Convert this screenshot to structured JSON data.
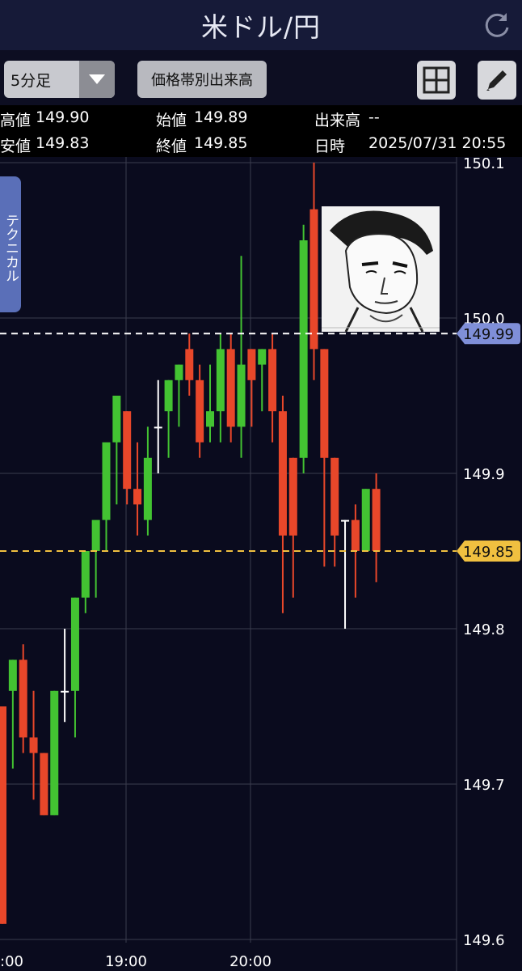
{
  "header": {
    "title": "米ドル/円"
  },
  "toolbar": {
    "timeframe": "5分足",
    "volume_button": "価格帯別出来高"
  },
  "info": {
    "high_label": "高値",
    "high_value": "149.90",
    "low_label": "安値",
    "low_value": "149.83",
    "open_label": "始値",
    "open_value": "149.89",
    "close_label": "終値",
    "close_value": "149.85",
    "volume_label": "出来高",
    "volume_value": "--",
    "datetime_label": "日時",
    "datetime_value": "2025/07/31 20:55"
  },
  "side_tab": {
    "label": "テクニカル"
  },
  "colors": {
    "up": "#43c332",
    "down": "#e8472a",
    "doji": "#ffffff",
    "bid_line": "#ffffff",
    "last_line": "#f0c040",
    "grid": "#3b3d4e",
    "background": "#0a0b1e"
  },
  "chart_data": {
    "type": "candlestick",
    "title": "米ドル/円",
    "interval": "5分足",
    "ylim": [
      149.6,
      150.1
    ],
    "y_ticks": [
      "149.6",
      "149.7",
      "149.8",
      "149.9",
      "150.0",
      "150.1"
    ],
    "x_ticks": [
      "19:00",
      "20:00"
    ],
    "x_tick_labels_shown": [
      ":00",
      "19:00",
      "20:00"
    ],
    "markers": [
      {
        "label": "149.99",
        "value": 149.99,
        "style": "dashed-white"
      },
      {
        "label": "149.85",
        "value": 149.85,
        "style": "dashed-yellow"
      }
    ],
    "candles": [
      {
        "open": 149.75,
        "high": 149.75,
        "low": 149.61,
        "close": 149.61
      },
      {
        "open": 149.76,
        "high": 149.78,
        "low": 149.71,
        "close": 149.78
      },
      {
        "open": 149.78,
        "high": 149.79,
        "low": 149.72,
        "close": 149.73
      },
      {
        "open": 149.73,
        "high": 149.76,
        "low": 149.69,
        "close": 149.72
      },
      {
        "open": 149.72,
        "high": 149.72,
        "low": 149.68,
        "close": 149.68
      },
      {
        "open": 149.68,
        "high": 149.76,
        "low": 149.68,
        "close": 149.76
      },
      {
        "open": 149.76,
        "high": 149.8,
        "low": 149.74,
        "close": 149.76
      },
      {
        "open": 149.76,
        "high": 149.82,
        "low": 149.73,
        "close": 149.82
      },
      {
        "open": 149.82,
        "high": 149.85,
        "low": 149.81,
        "close": 149.85
      },
      {
        "open": 149.85,
        "high": 149.86,
        "low": 149.82,
        "close": 149.87
      },
      {
        "open": 149.87,
        "high": 149.91,
        "low": 149.85,
        "close": 149.92
      },
      {
        "open": 149.92,
        "high": 149.95,
        "low": 149.88,
        "close": 149.95
      },
      {
        "open": 149.94,
        "high": 149.94,
        "low": 149.88,
        "close": 149.89
      },
      {
        "open": 149.89,
        "high": 149.92,
        "low": 149.86,
        "close": 149.88
      },
      {
        "open": 149.87,
        "high": 149.93,
        "low": 149.86,
        "close": 149.91
      },
      {
        "open": 149.93,
        "high": 149.96,
        "low": 149.9,
        "close": 149.93
      },
      {
        "open": 149.94,
        "high": 149.96,
        "low": 149.91,
        "close": 149.96
      },
      {
        "open": 149.96,
        "high": 149.97,
        "low": 149.93,
        "close": 149.97
      },
      {
        "open": 149.98,
        "high": 149.99,
        "low": 149.95,
        "close": 149.96
      },
      {
        "open": 149.96,
        "high": 149.97,
        "low": 149.91,
        "close": 149.92
      },
      {
        "open": 149.93,
        "high": 149.97,
        "low": 149.92,
        "close": 149.94
      },
      {
        "open": 149.94,
        "high": 149.99,
        "low": 149.92,
        "close": 149.98
      },
      {
        "open": 149.98,
        "high": 149.99,
        "low": 149.92,
        "close": 149.93
      },
      {
        "open": 149.93,
        "high": 150.04,
        "low": 149.91,
        "close": 149.97
      },
      {
        "open": 149.98,
        "high": 149.98,
        "low": 149.93,
        "close": 149.96
      },
      {
        "open": 149.97,
        "high": 149.98,
        "low": 149.94,
        "close": 149.98
      },
      {
        "open": 149.98,
        "high": 149.99,
        "low": 149.92,
        "close": 149.94
      },
      {
        "open": 149.94,
        "high": 149.95,
        "low": 149.81,
        "close": 149.86
      },
      {
        "open": 149.91,
        "high": 149.91,
        "low": 149.82,
        "close": 149.86
      },
      {
        "open": 149.91,
        "high": 150.06,
        "low": 149.9,
        "close": 150.05
      },
      {
        "open": 150.07,
        "high": 150.1,
        "low": 149.96,
        "close": 149.98
      },
      {
        "open": 149.98,
        "high": 149.98,
        "low": 149.84,
        "close": 149.91
      },
      {
        "open": 149.91,
        "high": 149.91,
        "low": 149.84,
        "close": 149.86
      },
      {
        "open": 149.87,
        "high": 149.87,
        "low": 149.8,
        "close": 149.87
      },
      {
        "open": 149.87,
        "high": 149.88,
        "low": 149.82,
        "close": 149.85
      },
      {
        "open": 149.85,
        "high": 149.89,
        "low": 149.85,
        "close": 149.89
      },
      {
        "open": 149.89,
        "high": 149.9,
        "low": 149.83,
        "close": 149.85
      }
    ]
  }
}
